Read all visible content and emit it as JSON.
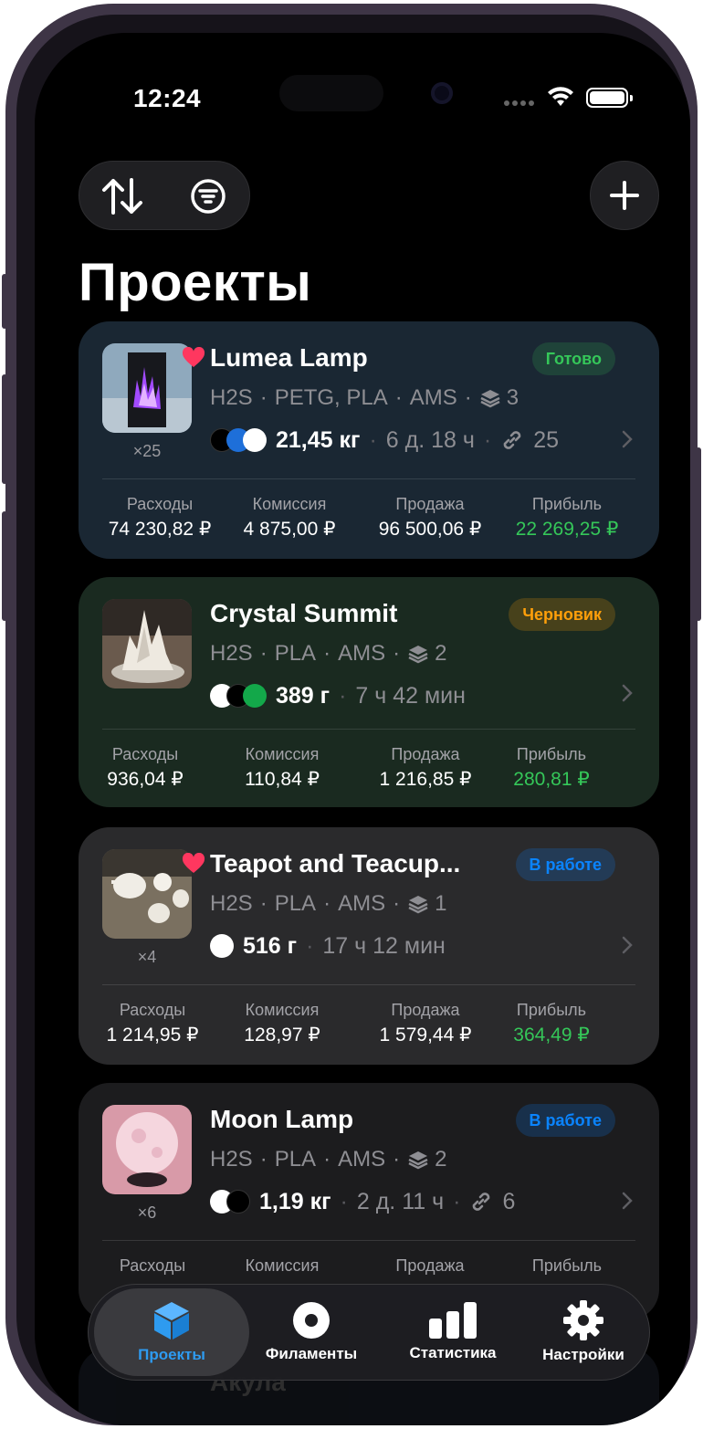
{
  "status": {
    "time": "12:24"
  },
  "page_title": "Проекты",
  "toolbar": {
    "sort_icon": "arrow-up-arrow-down-icon",
    "filter_icon": "filter-icon",
    "add_icon": "plus-icon"
  },
  "labels": {
    "expenses": "Расходы",
    "commission": "Комиссия",
    "sale": "Продажа",
    "profit": "Прибыль"
  },
  "projects": [
    {
      "title": "Lumea Lamp",
      "favorite": true,
      "quantity": "×25",
      "status": "Готово",
      "status_color": "#35c759",
      "printer": "H2S",
      "materials": "PETG, PLA",
      "system": "AMS",
      "plates": "3",
      "filament_colors": [
        "#000000",
        "#1e6fd9",
        "#ffffff"
      ],
      "weight": "21,45 кг",
      "time": "6 д. 18 ч",
      "links": "25",
      "expenses": "74 230,82 ₽",
      "commission": "4 875,00 ₽",
      "sale": "96 500,06 ₽",
      "profit": "22 269,25 ₽"
    },
    {
      "title": "Crystal Summit",
      "favorite": false,
      "quantity": "",
      "status": "Черновик",
      "status_color": "#ff9f0a",
      "printer": "H2S",
      "materials": "PLA",
      "system": "AMS",
      "plates": "2",
      "filament_colors": [
        "#ffffff",
        "#000000",
        "#13a84a"
      ],
      "weight": "389 г",
      "time": "7 ч 42 мин",
      "expenses": "936,04 ₽",
      "commission": "110,84 ₽",
      "sale": "1 216,85 ₽",
      "profit": "280,81 ₽"
    },
    {
      "title": "Teapot and Teacup...",
      "favorite": true,
      "quantity": "×4",
      "status": "В работе",
      "status_color": "#0a84ff",
      "printer": "H2S",
      "materials": "PLA",
      "system": "AMS",
      "plates": "1",
      "filament_colors": [
        "#ffffff"
      ],
      "weight": "516 г",
      "time": "17 ч 12 мин",
      "expenses": "1 214,95 ₽",
      "commission": "128,97 ₽",
      "sale": "1 579,44 ₽",
      "profit": "364,49 ₽"
    },
    {
      "title": "Moon Lamp",
      "favorite": false,
      "quantity": "×6",
      "status": "В работе",
      "status_color": "#0a84ff",
      "printer": "H2S",
      "materials": "PLA",
      "system": "AMS",
      "plates": "2",
      "filament_colors": [
        "#ffffff",
        "#000000"
      ],
      "weight": "1,19 кг",
      "time": "2 д. 11 ч",
      "links": "6"
    },
    {
      "title": "Акула"
    }
  ],
  "tabs": [
    {
      "label": "Проекты",
      "icon": "cube-icon",
      "active": true
    },
    {
      "label": "Филаменты",
      "icon": "spool-icon",
      "active": false
    },
    {
      "label": "Статистика",
      "icon": "bar-chart-icon",
      "active": false
    },
    {
      "label": "Настройки",
      "icon": "gear-icon",
      "active": false
    }
  ]
}
